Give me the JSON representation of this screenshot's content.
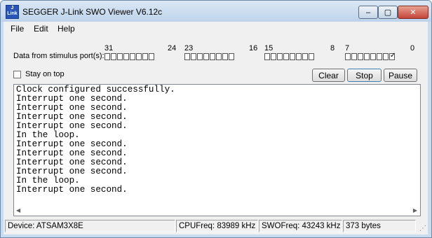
{
  "window": {
    "title": "SEGGER J-Link SWO Viewer V6.12c",
    "app_icon_text": "J\nLink"
  },
  "titlebar_buttons": {
    "minimize": "–",
    "maximize": "▢",
    "close": "✕"
  },
  "menu": [
    "File",
    "Edit",
    "Help"
  ],
  "stimulus": {
    "label": "Data from stimulus port(s):",
    "port_numbers": [
      "31",
      "24",
      "23",
      "16",
      "15",
      "8",
      "7",
      "0"
    ],
    "checked_ports": [
      0
    ]
  },
  "stay_on_top": {
    "label": "Stay on top",
    "checked": false
  },
  "buttons": {
    "clear": "Clear",
    "stop": "Stop",
    "pause": "Pause"
  },
  "output_lines": [
    "Clock configured successfully.",
    "Interrupt one second.",
    "Interrupt one second.",
    "Interrupt one second.",
    "Interrupt one second.",
    "In the loop.",
    "Interrupt one second.",
    "Interrupt one second.",
    "Interrupt one second.",
    "Interrupt one second.",
    "In the loop.",
    "Interrupt one second."
  ],
  "status": {
    "device": "Device: ATSAM3X8E",
    "cpu": "CPUFreq: 83989 kHz",
    "swo": "SWOFreq: 43243 kHz",
    "bytes": "373 bytes"
  }
}
